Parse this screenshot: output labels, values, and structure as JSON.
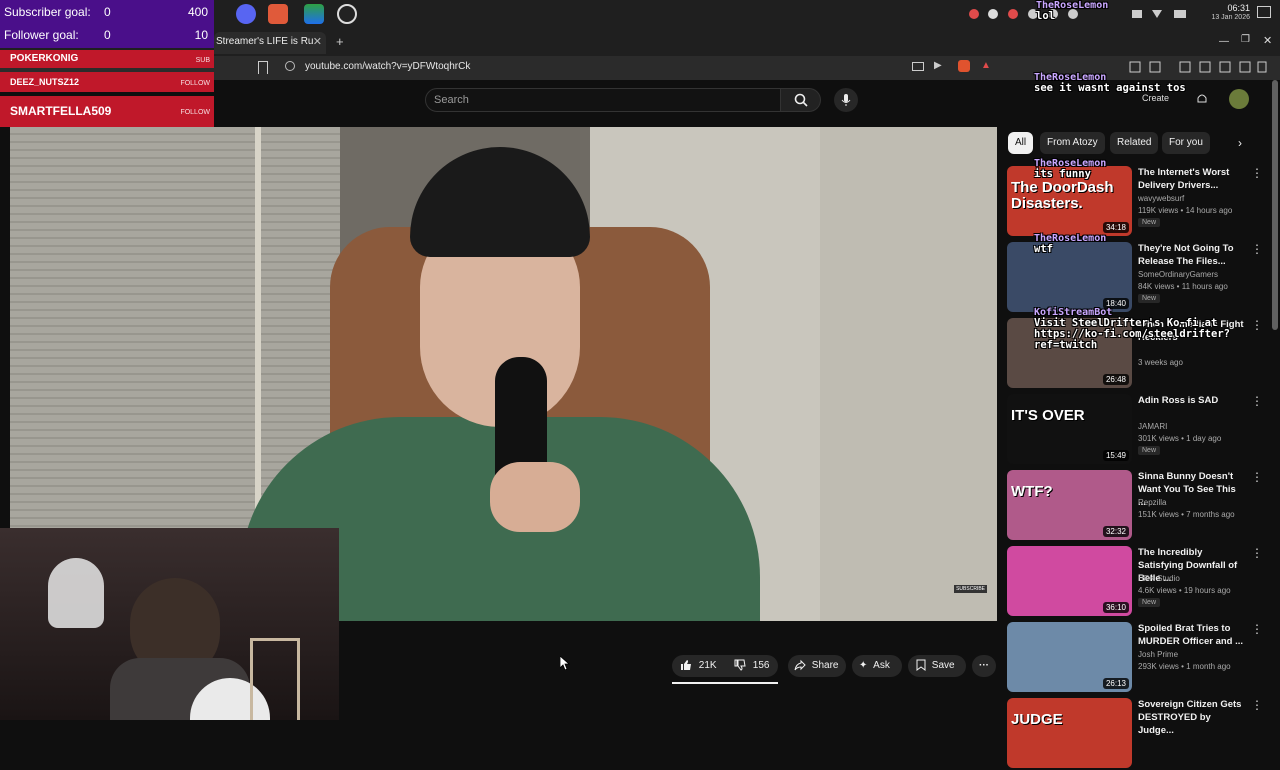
{
  "overlay": {
    "goals": [
      {
        "label": "Subscriber goal:",
        "current": "0",
        "target": "400"
      },
      {
        "label": "Follower goal:",
        "current": "0",
        "target": "10"
      }
    ],
    "alerts": [
      {
        "name": "POKERKONIG",
        "tag": "SUB"
      },
      {
        "name": "DEEZ_NUTSZ12",
        "tag": "FOLLOW"
      },
      {
        "name": "SMARTFELLA509",
        "tag": "FOLLOW"
      }
    ],
    "chat": [
      {
        "user": "TheRoseLemon",
        "msg": "lol"
      },
      {
        "user": "TheRoseLemon",
        "msg": "see it wasnt against tos"
      },
      {
        "user": "TheRoseLemon",
        "msg": "its funny"
      },
      {
        "user": "TheRoseLemon",
        "msg": "wtf"
      },
      {
        "user": "KofiStreamBot",
        "msg": "Visit SteelDrifter's Ko-fi at https://ko-fi.com/steeldrifter?ref=twitch"
      }
    ]
  },
  "system": {
    "clock_time": "06:31",
    "clock_date": "13 Jan 2026"
  },
  "browser": {
    "tab_title": "Streamer's LIFE is Ru",
    "url": "youtube.com/watch?v=yDFWtoqhrCk"
  },
  "youtube": {
    "search_placeholder": "Search",
    "create_label": "Create",
    "video_subscribe_tag": "SUBSCRIBE",
    "actions": {
      "likes": "21K",
      "dislikes": "156",
      "share": "Share",
      "ask": "Ask",
      "save": "Save"
    },
    "chips": [
      "All",
      "From Atozy",
      "Related",
      "For you"
    ],
    "recommendations": [
      {
        "title": "The Internet's Worst Delivery Drivers...",
        "channel": "wavywebsurf",
        "meta": "119K views • 14 hours ago",
        "badge": "New",
        "duration": "34:18",
        "thumb_text": "The DoorDash Disasters.",
        "color": "#c0392b"
      },
      {
        "title": "They're Not Going To Release The Files...",
        "channel": "SomeOrdinaryGamers",
        "meta": "84K views • 11 hours ago",
        "badge": "New",
        "duration": "18:40",
        "thumb_text": "",
        "color": "#3a4a66"
      },
      {
        "title": "When Comedians Fight Hecklers",
        "channel": "",
        "meta": "3 weeks ago",
        "badge": "",
        "duration": "26:48",
        "thumb_text": "",
        "color": "#5a4a44"
      },
      {
        "title": "Adin Ross is SAD",
        "channel": "JAMARI",
        "meta": "301K views • 1 day ago",
        "badge": "New",
        "duration": "15:49",
        "thumb_text": "IT'S OVER",
        "color": "#111111"
      },
      {
        "title": "Sinna Bunny Doesn't Want You To See This ...",
        "channel": "Repzilla",
        "meta": "151K views • 7 months ago",
        "badge": "",
        "duration": "32:32",
        "thumb_text": "WTF?",
        "color": "#b05a8a"
      },
      {
        "title": "The Incredibly Satisfying Downfall of Belle ...",
        "channel": "HRK Studio",
        "meta": "4.6K views • 19 hours ago",
        "badge": "New",
        "duration": "36:10",
        "thumb_text": "",
        "color": "#d04aa0"
      },
      {
        "title": "Spoiled Brat Tries to MURDER Officer and ...",
        "channel": "Josh Prime",
        "meta": "293K views • 1 month ago",
        "badge": "",
        "duration": "26:13",
        "thumb_text": "",
        "color": "#6d8aa8"
      },
      {
        "title": "Sovereign Citizen Gets DESTROYED by Judge...",
        "channel": "",
        "meta": "",
        "badge": "",
        "duration": "",
        "thumb_text": "JUDGE",
        "color": "#c0392b"
      }
    ]
  }
}
